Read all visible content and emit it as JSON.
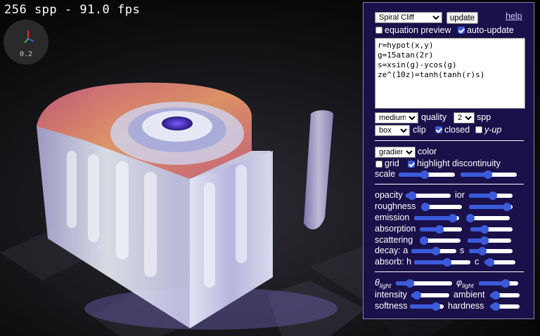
{
  "stats": {
    "fps_text": "256 spp - 91.0 fps"
  },
  "gizmo": {
    "scale": "0.2"
  },
  "panel": {
    "preset": "Spiral Cliff",
    "update_label": "update",
    "help_label": "help",
    "equation_preview_label": "equation preview",
    "equation_preview_checked": false,
    "auto_update_label": "auto-update",
    "auto_update_checked": true,
    "equation": "r=hypot(x,y)\ng=15atan(2r)\ns=xsin(g)-ycos(g)\nze^(10z)=tanh(tanh(r)s)",
    "quality_value": "medium",
    "quality_label": "quality",
    "spp_value": "2⁸",
    "spp_label": "spp",
    "clip_value": "box",
    "clip_label": "clip",
    "closed_label": "closed",
    "closed_checked": true,
    "yup_label": "y-up",
    "yup_checked": false,
    "color_value": "gradient",
    "color_label": "color",
    "grid_label": "grid",
    "grid_checked": false,
    "highlight_label": "highlight discontinuity",
    "highlight_checked": true,
    "scale_label": "scale",
    "scale_slider_1": 0.45,
    "scale_slider_2": 0.48,
    "opacity_label": "opacity",
    "opacity": 0.05,
    "ior_label": "ior",
    "ior": 0.55,
    "roughness_label": "roughness",
    "roughness": 0.0,
    "roughness_b": 0.95,
    "emission_label": "emission",
    "emission": 0.95,
    "emission_b": 0.0,
    "absorption_label": "absorption",
    "absorption": 0.45,
    "absorption_b": 0.3,
    "scattering_label": "scattering",
    "scattering": 0.0,
    "scattering_b": 0.35,
    "decay_a_label": "decay: a",
    "decay_a": 0.55,
    "decay_s_label": "s",
    "decay_s": 0.25,
    "absorb_h_label": "absorb: h",
    "absorb_h": 0.6,
    "absorb_c_label": "c",
    "absorb_c": 0.05,
    "theta_symbol": "θ",
    "theta_sub": "light",
    "theta": 0.2,
    "phi_symbol": "φ",
    "phi_sub": "light",
    "phi": 0.72,
    "intensity_label": "intensity",
    "intensity": 0.05,
    "ambient_label": "ambient",
    "ambient": 0.05,
    "softness_label": "softness",
    "softness": 0.85,
    "hardness_label": "hardness",
    "hardness": 0.05
  },
  "colors": {
    "panel_bg": "#1a104a",
    "accent": "#3b5bdb"
  }
}
